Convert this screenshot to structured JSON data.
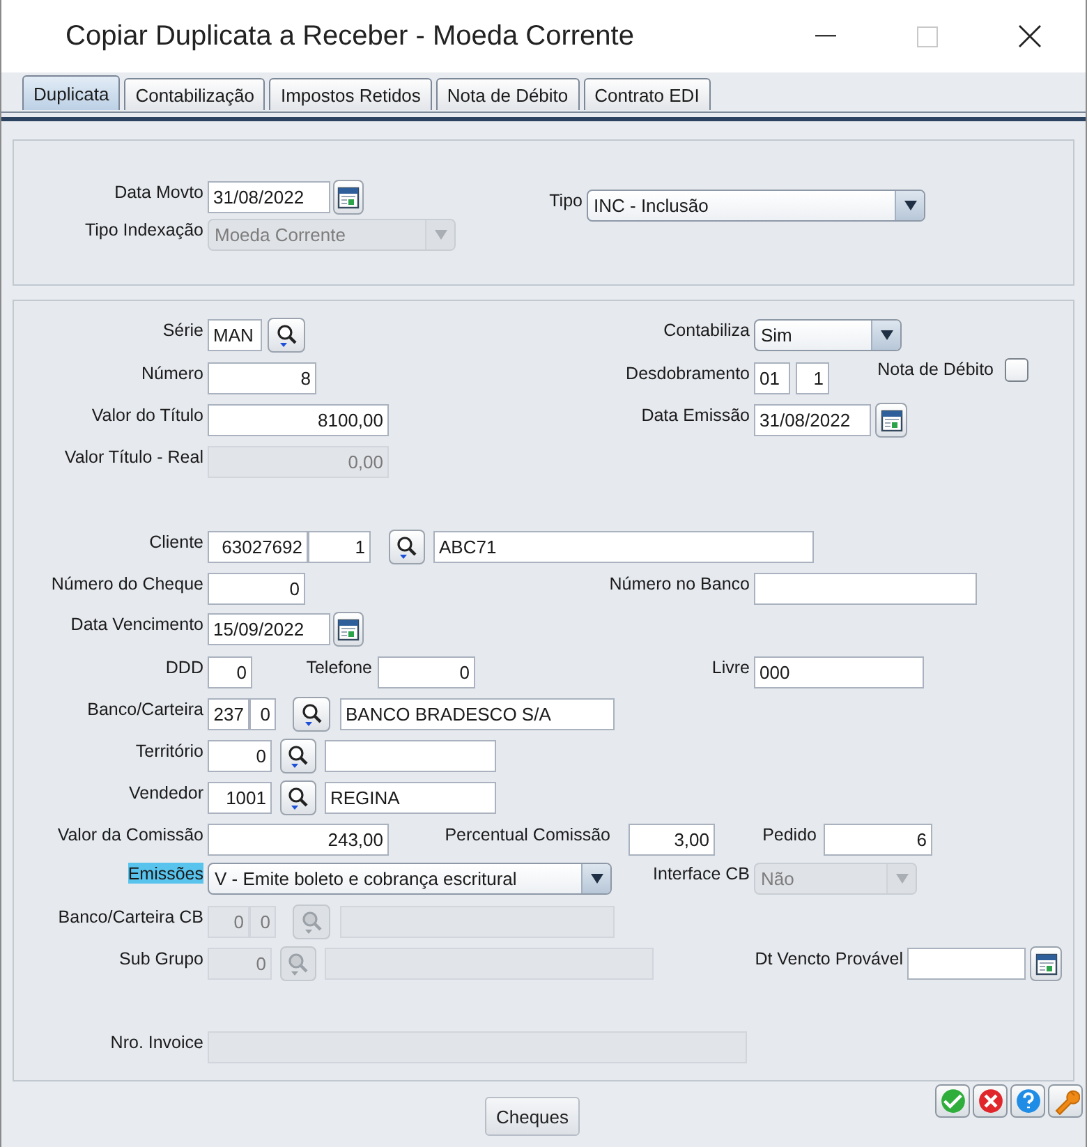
{
  "window": {
    "title": "Copiar Duplicata a Receber - Moeda Corrente"
  },
  "tabs": [
    {
      "label": "Duplicata",
      "selected": true
    },
    {
      "label": "Contabilização",
      "selected": false
    },
    {
      "label": "Impostos Retidos",
      "selected": false
    },
    {
      "label": "Nota de Débito",
      "selected": false
    },
    {
      "label": "Contrato EDI",
      "selected": false
    }
  ],
  "header_panel": {
    "rows": [
      {
        "fields": [
          {
            "label": "Data Movto",
            "kind": "date",
            "inputs": [
              "31/08/2022"
            ]
          },
          {
            "label": "Tipo",
            "kind": "combo",
            "inputs": [
              "INC - Inclusão"
            ]
          }
        ]
      },
      {
        "fields": [
          {
            "label": "Tipo Indexação",
            "kind": "combo",
            "inputs": [
              "Moeda Corrente"
            ],
            "disabled": true
          }
        ]
      }
    ]
  },
  "detail_panel": {
    "rows": [
      {
        "fields": [
          {
            "label": "Série",
            "kind": "lookup",
            "inputs": [
              "MAN"
            ]
          },
          {
            "label": "Contabiliza",
            "kind": "combo",
            "inputs": [
              "Sim"
            ]
          }
        ]
      },
      {
        "fields": [
          {
            "label": "Número",
            "kind": "text",
            "inputs": [
              "8"
            ]
          },
          {
            "label": "Desdobramento",
            "kind": "text",
            "inputs": [
              "01",
              "1"
            ]
          },
          {
            "label": "Nota de Débito",
            "kind": "checkbox",
            "checked": false
          }
        ]
      },
      {
        "fields": [
          {
            "label": "Valor do Título",
            "kind": "text",
            "inputs": [
              "8100,00"
            ]
          },
          {
            "label": "Data Emissão",
            "kind": "date",
            "inputs": [
              "31/08/2022"
            ]
          }
        ]
      },
      {
        "fields": [
          {
            "label": "Valor Título - Real",
            "kind": "text",
            "inputs": [
              "0,00"
            ],
            "disabled": true
          }
        ]
      },
      {
        "fields": [
          {
            "label": "Cliente",
            "kind": "lookup",
            "inputs": [
              "63027692",
              "1"
            ],
            "after": [
              "ABC71"
            ]
          }
        ]
      },
      {
        "fields": [
          {
            "label": "Número do Cheque",
            "kind": "text",
            "inputs": [
              "0"
            ]
          },
          {
            "label": "Número no Banco",
            "kind": "text"
          }
        ]
      },
      {
        "fields": [
          {
            "label": "Data Vencimento",
            "kind": "date",
            "inputs": [
              "15/09/2022"
            ]
          }
        ]
      },
      {
        "fields": [
          {
            "label": "DDD",
            "kind": "text",
            "inputs": [
              "0"
            ]
          },
          {
            "label": "Telefone",
            "kind": "text",
            "inputs": [
              "0"
            ]
          },
          {
            "label": "Livre",
            "kind": "text",
            "inputs": [
              "000"
            ]
          }
        ]
      },
      {
        "fields": [
          {
            "label": "Banco/Carteira",
            "kind": "lookup",
            "inputs": [
              "237",
              "0"
            ],
            "after": [
              "BANCO BRADESCO S/A"
            ]
          }
        ]
      },
      {
        "fields": [
          {
            "label": "Território",
            "kind": "lookup",
            "inputs": [
              "0"
            ]
          }
        ]
      },
      {
        "fields": [
          {
            "label": "Vendedor",
            "kind": "lookup",
            "inputs": [
              "1001"
            ],
            "after": [
              "REGINA"
            ]
          }
        ]
      },
      {
        "fields": [
          {
            "label": "Valor da Comissão",
            "kind": "text",
            "inputs": [
              "243,00"
            ]
          },
          {
            "label": "Percentual Comissão",
            "kind": "text",
            "inputs": [
              "3,00"
            ]
          },
          {
            "label": "Pedido",
            "kind": "text",
            "inputs": [
              "6"
            ]
          }
        ]
      },
      {
        "fields": [
          {
            "label": "Emissões",
            "kind": "combo",
            "inputs": [
              "V - Emite boleto e cobrança escritural"
            ],
            "focused": true
          },
          {
            "label": "Interface CB",
            "kind": "combo",
            "inputs": [
              "Não"
            ],
            "disabled": true
          }
        ]
      },
      {
        "fields": [
          {
            "label": "Banco/Carteira CB",
            "kind": "lookup",
            "inputs": [
              "0",
              "0"
            ],
            "disabled": true
          }
        ]
      },
      {
        "fields": [
          {
            "label": "Sub Grupo",
            "kind": "lookup",
            "inputs": [
              "0"
            ],
            "disabled": true
          },
          {
            "label": "Dt Vencto Provável",
            "kind": "date"
          }
        ]
      },
      {
        "fields": [
          {
            "label": "Nro. Invoice",
            "kind": "text",
            "disabled": true
          }
        ]
      }
    ]
  },
  "buttons": [
    {
      "label": "Cheques"
    }
  ]
}
